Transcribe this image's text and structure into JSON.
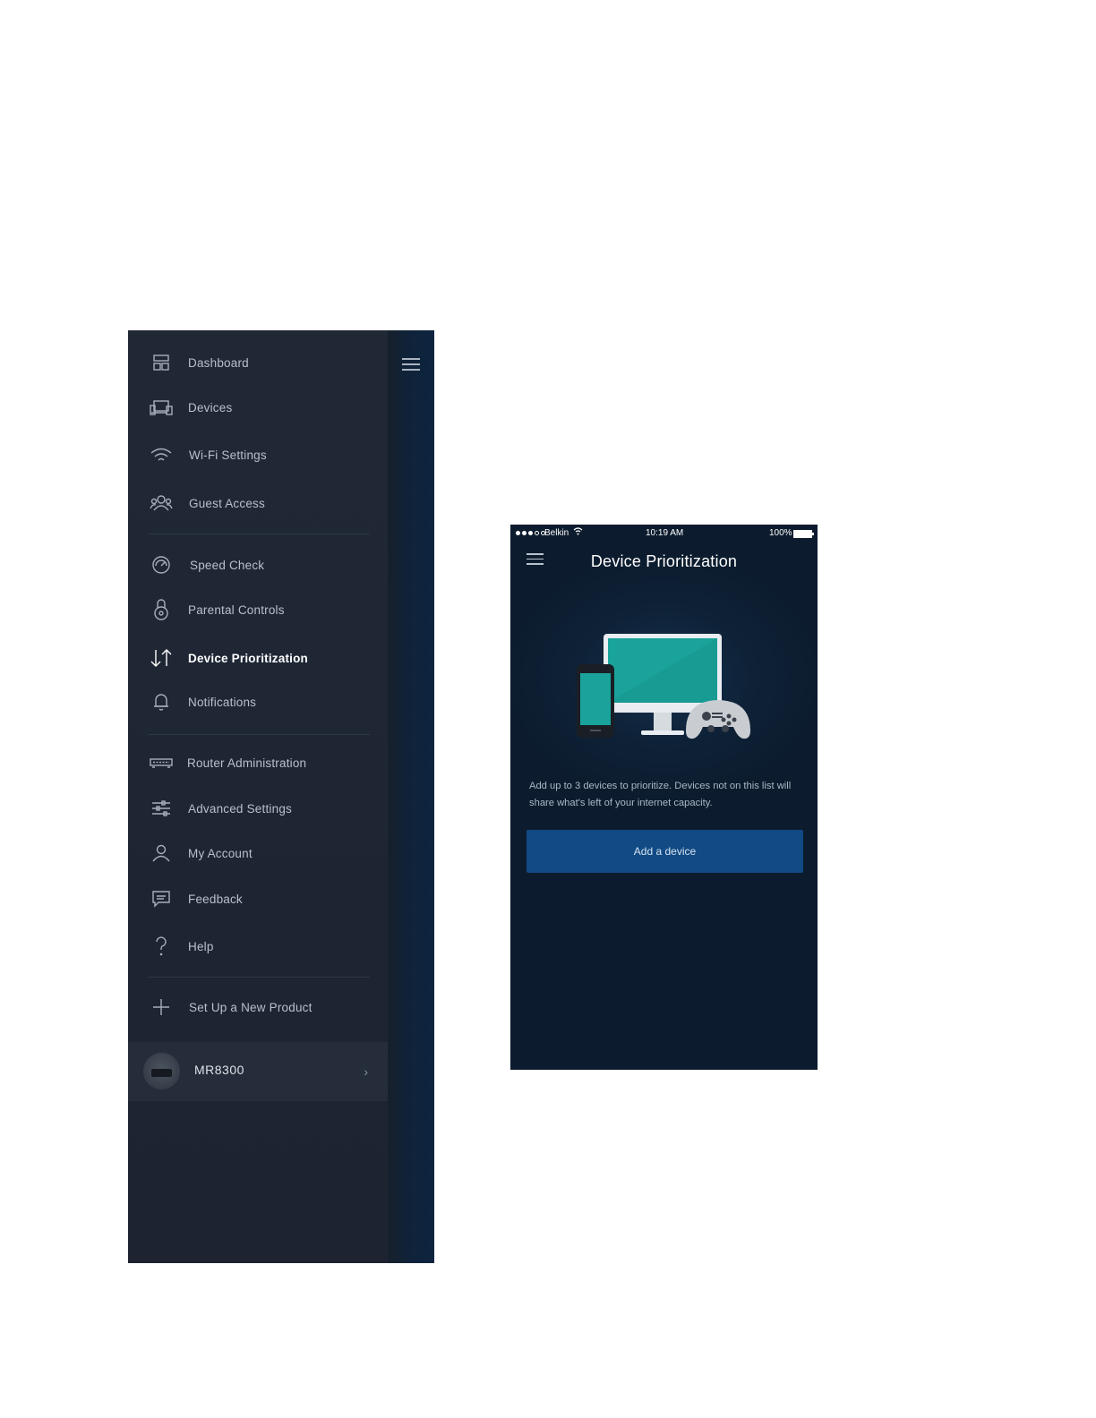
{
  "drawer": {
    "items": [
      {
        "label": "Dashboard",
        "icon": "dashboard-icon"
      },
      {
        "label": "Devices",
        "icon": "devices-icon"
      },
      {
        "label": "Wi-Fi Settings",
        "icon": "wifi-icon"
      },
      {
        "label": "Guest Access",
        "icon": "guest-access-icon"
      },
      {
        "label": "Speed Check",
        "icon": "speedometer-icon"
      },
      {
        "label": "Parental Controls",
        "icon": "lock-icon"
      },
      {
        "label": "Device Prioritization",
        "icon": "prioritization-arrows-icon",
        "active": true
      },
      {
        "label": "Notifications",
        "icon": "bell-icon"
      },
      {
        "label": "Router Administration",
        "icon": "router-icon"
      },
      {
        "label": "Advanced Settings",
        "icon": "sliders-icon"
      },
      {
        "label": "My Account",
        "icon": "user-icon"
      },
      {
        "label": "Feedback",
        "icon": "feedback-icon"
      },
      {
        "label": "Help",
        "icon": "question-icon"
      },
      {
        "label": "Set Up a New Product",
        "icon": "plus-icon"
      }
    ],
    "product": {
      "name": "MR8300"
    }
  },
  "phone": {
    "status": {
      "carrier": "Belkin",
      "time": "10:19 AM",
      "battery": "100%"
    },
    "title": "Device Prioritization",
    "description": "Add up to 3 devices to prioritize. Devices not on this list will share what's left of your internet capacity.",
    "add_button": "Add a device"
  },
  "colors": {
    "drawer_bg": "#1e2532",
    "phone_bg": "#0e2136",
    "button_blue": "#114a84",
    "screen_teal": "#1aa39a"
  }
}
